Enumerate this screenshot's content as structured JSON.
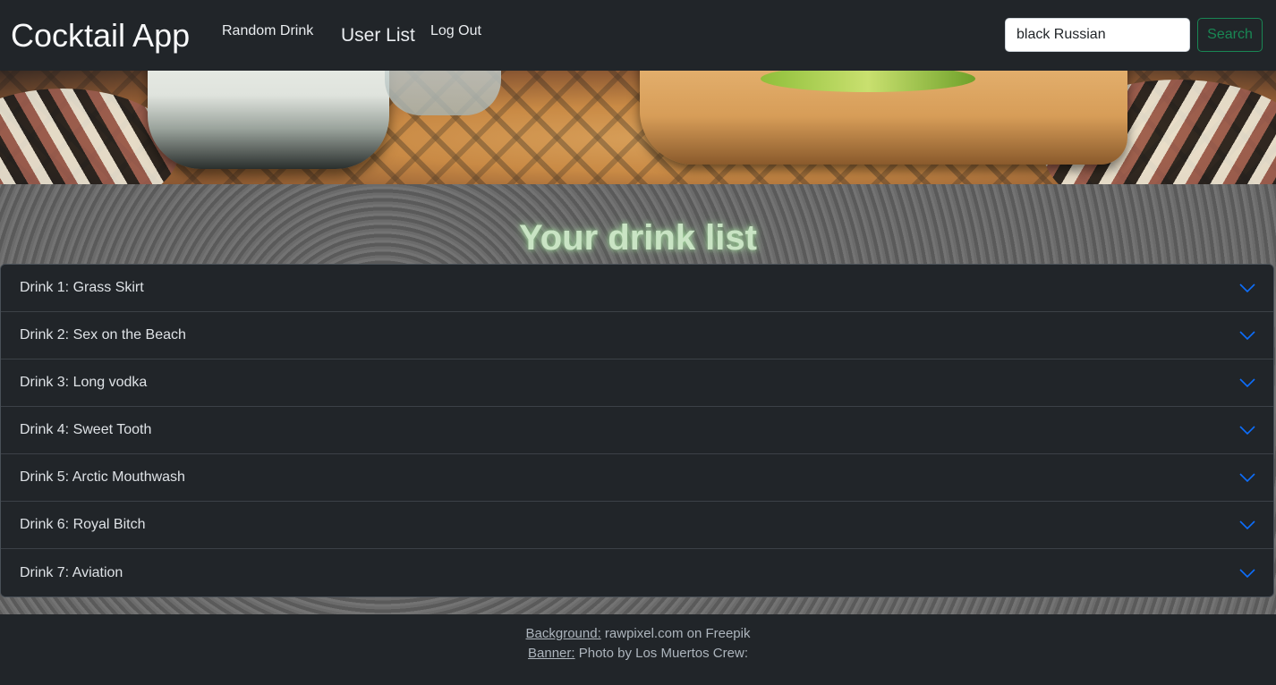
{
  "navbar": {
    "brand": "Cocktail App",
    "links": {
      "random_drink": "Random Drink",
      "user_list": "User List",
      "log_out": "Log Out"
    },
    "search": {
      "value": "black Russian",
      "button_label": "Search"
    }
  },
  "main": {
    "title": "Your drink list",
    "drinks": [
      {
        "label": "Drink 1: Grass Skirt"
      },
      {
        "label": "Drink 2: Sex on the Beach"
      },
      {
        "label": "Drink 3: Long vodka"
      },
      {
        "label": "Drink 4: Sweet Tooth"
      },
      {
        "label": "Drink 5: Arctic Mouthwash"
      },
      {
        "label": "Drink 6: Royal Bitch"
      },
      {
        "label": "Drink 7: Aviation"
      }
    ]
  },
  "footer": {
    "background_label": "Background:",
    "background_text": " rawpixel.com on Freepik",
    "banner_label": "Banner:",
    "banner_text": " Photo by Los Muertos Crew:"
  },
  "colors": {
    "navbar_bg": "#212529",
    "search_accent": "#198754",
    "chevron": "#0d6efd",
    "title_glow": "#9fd69a"
  },
  "icons": {
    "accordion_toggle": "chevron-down-icon"
  }
}
